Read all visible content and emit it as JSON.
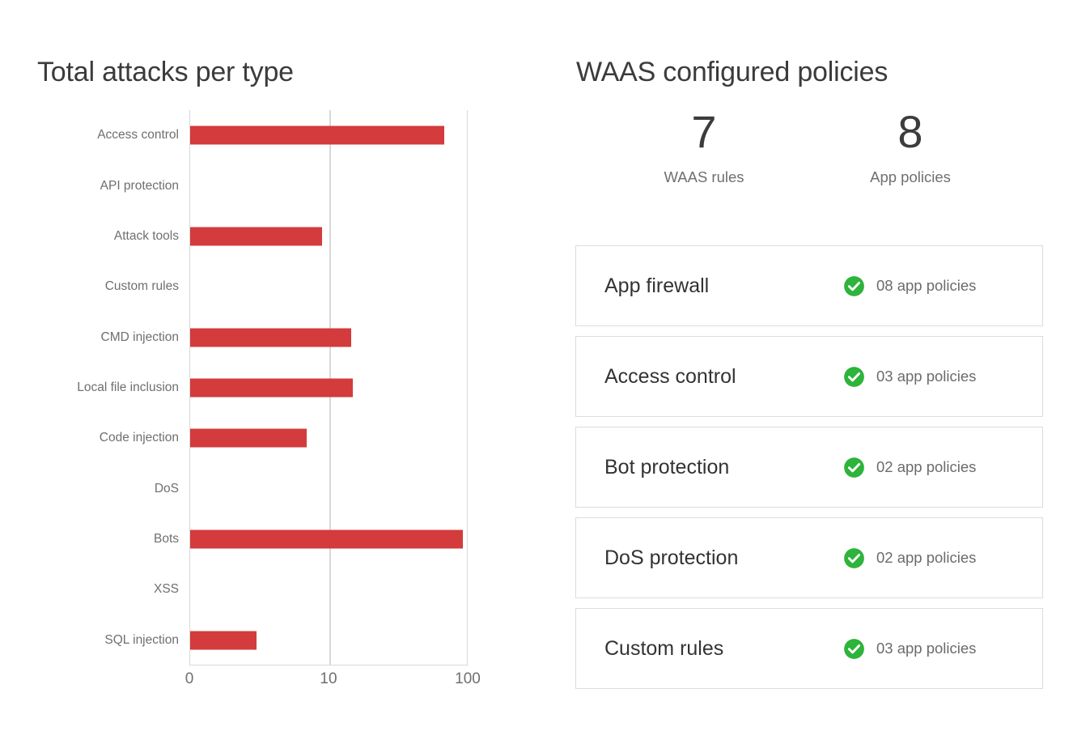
{
  "left_panel": {
    "title": "Total attacks per type"
  },
  "right_panel": {
    "title": "WAAS configured policies",
    "stats": [
      {
        "value": "7",
        "label": "WAAS rules"
      },
      {
        "value": "8",
        "label": "App policies"
      }
    ],
    "cards": [
      {
        "title": "App firewall",
        "count": "08 app policies",
        "icon": "check-circle-icon",
        "status": "enabled"
      },
      {
        "title": "Access control",
        "count": "03 app policies",
        "icon": "check-circle-icon",
        "status": "enabled"
      },
      {
        "title": "Bot protection",
        "count": "02 app policies",
        "icon": "check-circle-icon",
        "status": "enabled"
      },
      {
        "title": "DoS protection",
        "count": "02 app policies",
        "icon": "check-circle-icon",
        "status": "enabled"
      },
      {
        "title": "Custom rules",
        "count": "03 app policies",
        "icon": "check-circle-icon",
        "status": "enabled"
      }
    ]
  },
  "colors": {
    "bar": "#d33b3c",
    "status_ok": "#2eb33b",
    "grid": "#d8d8d8",
    "label": "#6f6f6f",
    "heading": "#3b3b3b"
  },
  "chart_data": {
    "type": "bar",
    "orientation": "horizontal",
    "title": "Total attacks per type",
    "xlabel": "",
    "ylabel": "",
    "grid": true,
    "legend": null,
    "xticks": [
      "0",
      "10",
      "100"
    ],
    "xtick_positions": [
      0,
      50,
      100
    ],
    "xlim": [
      0,
      100
    ],
    "note": "x axis is a compressed/log-like scale: 0 at left edge, 10 at mid, 100 at right edge",
    "categories": [
      "Access control",
      "API protection",
      "Attack tools",
      "Custom rules",
      "CMD injection",
      "Local file inclusion",
      "Code injection",
      "DoS",
      "Bots",
      "XSS",
      "SQL injection"
    ],
    "values": [
      91,
      0,
      9,
      0,
      11.5,
      11.7,
      8.4,
      0,
      98,
      0,
      4.8
    ],
    "bar_extent_pct": [
      91.3,
      0,
      47.4,
      0,
      57.8,
      58.4,
      41.9,
      0,
      98.0,
      0,
      23.8
    ],
    "values_unit": "attacks"
  }
}
